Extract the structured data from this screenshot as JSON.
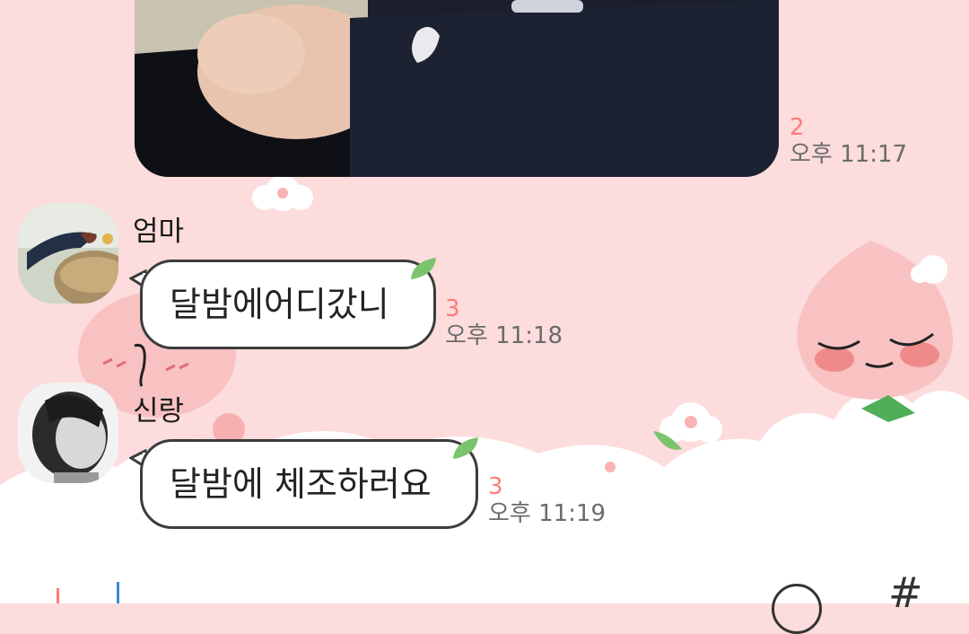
{
  "colors": {
    "background": "#fcdcdc",
    "bubble_bg": "#ffffff",
    "bubble_border": "#3c3c3c",
    "unread_count": "#ff7a7a",
    "timestamp": "#6b6b6b",
    "leaf_green": "#7cc36d",
    "input_caret": "#3a8ad8"
  },
  "messages": [
    {
      "type": "photo",
      "unread": "2",
      "time": "오후 11:17"
    },
    {
      "type": "text",
      "sender": "엄마",
      "avatar": "swallow-nest-photo",
      "text": "달밤에어디갔니",
      "unread": "3",
      "time": "오후 11:18"
    },
    {
      "type": "text",
      "sender": "신랑",
      "avatar": "child-profile-photo",
      "text": "달밤에 체조하러요",
      "unread": "3",
      "time": "오후 11:19"
    }
  ],
  "input_bar": {
    "icons": [
      "attach-icon",
      "emoji-icon",
      "hashtag-icon"
    ]
  }
}
